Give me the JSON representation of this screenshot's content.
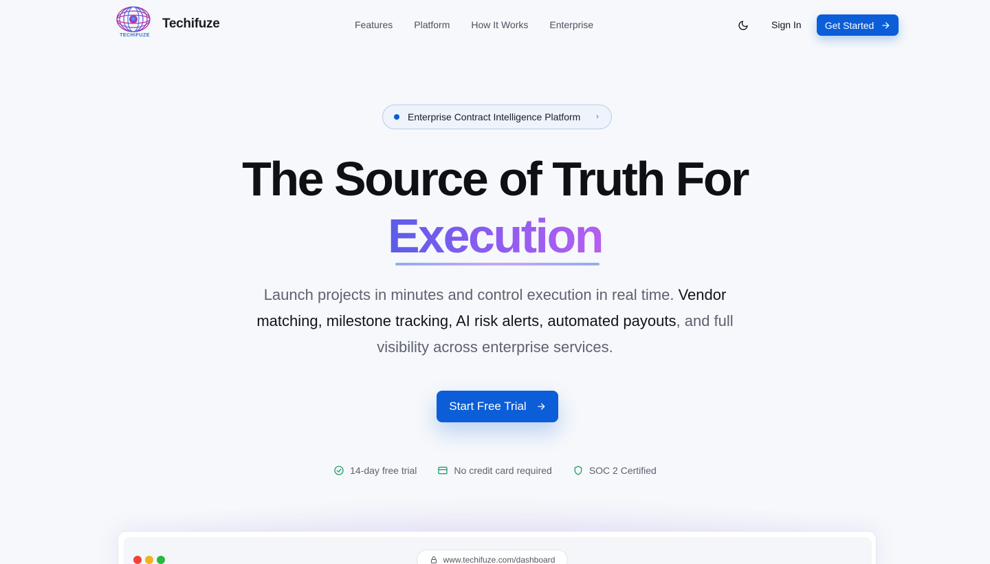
{
  "nav": {
    "brand": "Techifuze",
    "logo_text": "TECHIFUZE",
    "links": [
      "Features",
      "Platform",
      "How It Works",
      "Enterprise"
    ],
    "theme_icon": "moon-icon",
    "sign_in": "Sign In",
    "get_started": "Get Started"
  },
  "hero": {
    "pill": "Enterprise Contract Intelligence Platform",
    "headline": "The Source of Truth For",
    "headline_accent": "Execution",
    "sub_part1": "Launch projects in minutes and control execution in real time. ",
    "sub_bold": "Vendor matching, milestone tracking, AI risk alerts, automated payouts",
    "sub_part2": ", and full visibility across enterprise services.",
    "cta": "Start Free Trial",
    "badges": [
      {
        "icon": "check-circle-icon",
        "label": "14-day free trial"
      },
      {
        "icon": "credit-card-icon",
        "label": "No credit card required"
      },
      {
        "icon": "shield-icon",
        "label": "SOC 2 Certified"
      }
    ]
  },
  "preview": {
    "url": "www.techifuze.com/dashboard"
  },
  "colors": {
    "primary": "#0b5ed7",
    "accent_gradient_start": "#5b5ce8",
    "accent_gradient_end": "#b45ff0",
    "badge_green": "#22a06b"
  }
}
